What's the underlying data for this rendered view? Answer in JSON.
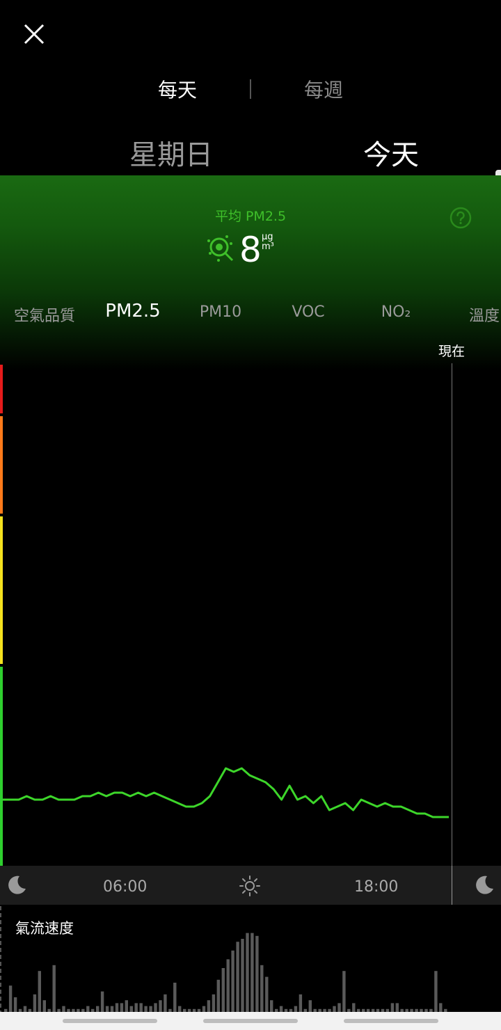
{
  "header": {
    "tabs": [
      {
        "label": "每天",
        "active": true
      },
      {
        "label": "每週",
        "active": false
      }
    ],
    "days": [
      {
        "label": "星期日",
        "active": false
      },
      {
        "label": "今天",
        "active": true
      }
    ]
  },
  "summary": {
    "avg_label": "平均 PM2.5",
    "value": "8",
    "unit_top": "μg",
    "unit_bottom": "m³"
  },
  "metrics": {
    "tabs": [
      "空氣品質",
      "PM2.5",
      "PM10",
      "VOC",
      "NO₂",
      "溫度"
    ],
    "active": "PM2.5"
  },
  "chart": {
    "now_label": "現在",
    "time_labels": [
      "06:00",
      "18:00"
    ],
    "line_color": "#3dd62a",
    "scale_colors": [
      "#e51b1b",
      "#ff7a1a",
      "#f5e21e",
      "#2fd02f"
    ]
  },
  "chart_data": [
    {
      "type": "line",
      "title": "",
      "xlabel": "",
      "ylabel": "",
      "x_range": [
        0,
        24
      ],
      "values": [
        9,
        9,
        9,
        10,
        9,
        9,
        10,
        9,
        9,
        9,
        10,
        10,
        11,
        10,
        11,
        11,
        10,
        11,
        10,
        11,
        10,
        9,
        8,
        7,
        7,
        8,
        10,
        14,
        18,
        17,
        18,
        16,
        15,
        14,
        12,
        9,
        13,
        9,
        10,
        8,
        10,
        6,
        7,
        8,
        6,
        9,
        8,
        7,
        8,
        7,
        7,
        6,
        5,
        5,
        4,
        4,
        4
      ]
    },
    {
      "type": "bar",
      "title": "氣流速度",
      "values": [
        1,
        9,
        5,
        1,
        2,
        1,
        6,
        14,
        4,
        1,
        16,
        1,
        2,
        1,
        1,
        1,
        1,
        2,
        1,
        2,
        7,
        2,
        2,
        3,
        3,
        4,
        2,
        3,
        3,
        2,
        2,
        3,
        4,
        6,
        1,
        10,
        2,
        1,
        1,
        1,
        1,
        2,
        4,
        6,
        11,
        15,
        18,
        21,
        24,
        25,
        27,
        27,
        26,
        16,
        12,
        4,
        1,
        2,
        1,
        1,
        2,
        6,
        1,
        4,
        1,
        1,
        1,
        1,
        2,
        3,
        14,
        1,
        3,
        1,
        1,
        1,
        1,
        1,
        1,
        1,
        3,
        3,
        1,
        1,
        1,
        1,
        1,
        1,
        1,
        14,
        3,
        1
      ]
    }
  ],
  "airflow": {
    "label": "氣流速度",
    "bar_color": "#5a5a5a"
  },
  "icons": {
    "close": "close-icon",
    "help": "help-icon",
    "particle": "particle-icon",
    "moon": "moon-icon",
    "sun": "sun-icon"
  }
}
